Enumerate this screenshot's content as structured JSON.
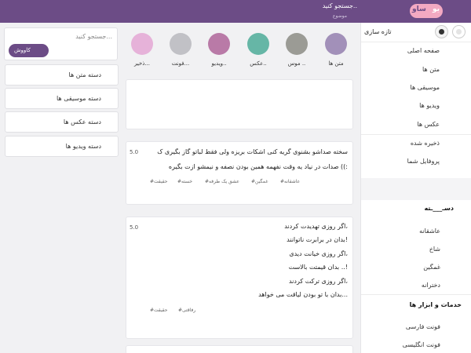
{
  "header": {
    "logo_a": "ساو",
    "logo_b": "یو",
    "search_text": "جستجو کنید..",
    "search_sub": "موضوع"
  },
  "sidebar": {
    "theme_label": "تازه سازی",
    "nav": [
      "صفحه اصلی",
      "متن ها",
      "موسیقی ها",
      "ویدیو ها",
      "عکس ها"
    ],
    "extra": [
      "ذخیره شده",
      "پروفایل شما"
    ],
    "category_heading": "دسـ___ـته",
    "categories": [
      "عاشقانه",
      "شاخ",
      "غمگین",
      "دخترانه"
    ],
    "tools_heading": "خدمات و ابزار ها",
    "tools": [
      "فونت فارسی",
      "فونت انگلیسی"
    ]
  },
  "left": {
    "search_placeholder": "جستجو کنید...",
    "search_button": "کاووش",
    "category_boxes": [
      "دسته متن ها",
      "دسته موسیقی ها",
      "دسته عکس ها",
      "دسته ویدیو ها"
    ]
  },
  "stories": [
    {
      "label": "متن ها",
      "color": "#a290b9"
    },
    {
      "label": "موس ..",
      "color": "#9b9b95"
    },
    {
      "label": "عکس..",
      "color": "#66b6a6"
    },
    {
      "label": "ویدیو..",
      "color": "#b97aa7"
    },
    {
      "label": "فونت...",
      "color": "#c1c1c6"
    },
    {
      "label": "ذخیر...",
      "color": "#e6b2d9"
    }
  ],
  "posts": [
    {
      "score": "5.0",
      "lines": [
        "سخته صداشو بشنوی گریه کنی اشکات بریزه ولی فقط لباتو گاز بگیری ک",
        "صدات در نیاد یه وقت نفهمه همین بودن نصفه و نیمشو ازت بگیره ((:"
      ],
      "tags": [
        "#عاشقانه",
        "#غمگین",
        "#عشق یک طرفه",
        "#خسته",
        "#حقیقت"
      ]
    },
    {
      "score": "5.0",
      "lines": [
        "اگر روزی تهدیدت کردند،",
        "بدان در برابرت ناتوانند!",
        "اگر روزی خیانت دیدی،",
        "بدان قیمتت بالاست ..!",
        "اگر روزی ترکت کردند،",
        "بدان با تو بودن لیاقت می خواهد..."
      ],
      "tags": [
        "#رفاقتی",
        "#حقیقت"
      ]
    }
  ]
}
